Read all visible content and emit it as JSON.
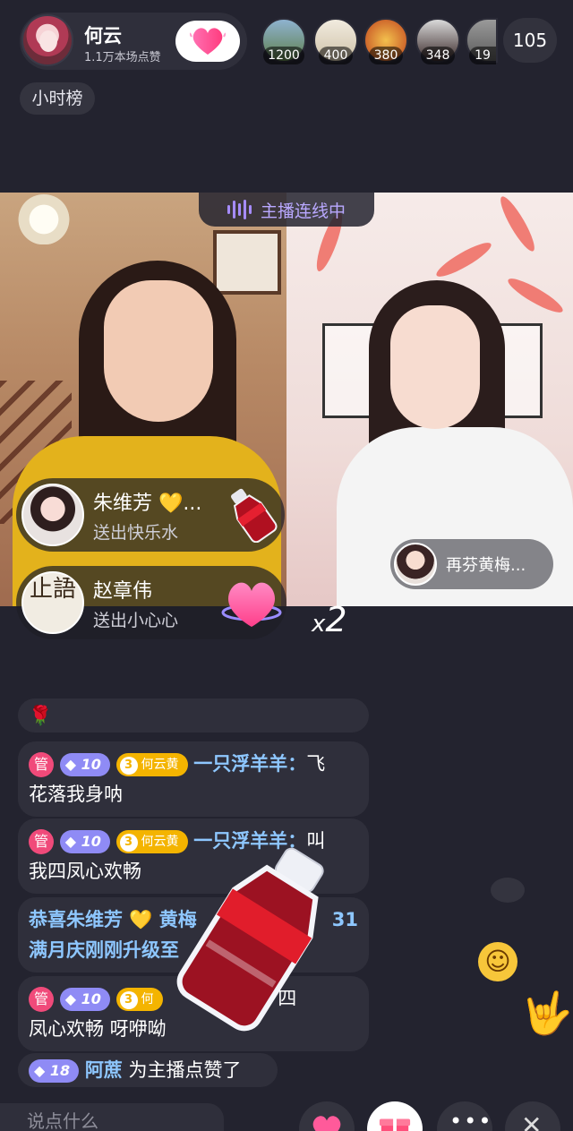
{
  "header": {
    "host_name": "何云",
    "host_likes": "1.1万本场点赞",
    "viewers": [
      {
        "badge": "1200",
        "color": "#6b8f6a"
      },
      {
        "badge": "400",
        "color": "#d9cfbd"
      },
      {
        "badge": "380",
        "color": "#e68a2e"
      },
      {
        "badge": "348",
        "color": "#4a3a3a"
      },
      {
        "badge": "19",
        "color": "#6d6d6d"
      }
    ],
    "viewer_count": "105",
    "rank_tag": "小时榜"
  },
  "video": {
    "link_status": "主播连线中",
    "guest_name": "再芬黄梅..."
  },
  "gifts": [
    {
      "name": "朱维芳 💛...",
      "desc": "送出快乐水"
    },
    {
      "name": "赵章伟",
      "desc": "送出小心心",
      "avatar_text": "止語",
      "combo_prefix": "x",
      "combo": "2"
    }
  ],
  "chat": {
    "rose": "🌹",
    "messages": [
      {
        "mgr": "管",
        "level": "10",
        "fan_level": "3",
        "fan_name": "何云黄",
        "user": "一只浮羊羊：",
        "text_inline": "飞",
        "text_line2": "花落我身呐"
      },
      {
        "mgr": "管",
        "level": "10",
        "fan_level": "3",
        "fan_name": "何云黄",
        "user": "一只浮羊羊：",
        "text_inline": "叫",
        "text_line2": "我四凤心欢畅"
      },
      {
        "line1": "恭喜朱维芳 💛 黄梅",
        "line1_end": "31",
        "line2": "满月庆刚刚升级至"
      },
      {
        "mgr": "管",
        "level": "10",
        "fan_level": "3",
        "fan_name": "何",
        "user": "羊：",
        "text_inline": "四",
        "text_line2": "凤心欢畅 呀咿呦"
      },
      {
        "level": "18",
        "user": "阿蔗",
        "text": "为主播点赞了"
      }
    ]
  },
  "bottom": {
    "input_placeholder": "说点什么"
  },
  "icons": [
    "heart-icon",
    "gift-icon",
    "more-icon",
    "close-icon",
    "laugh-emoji-icon",
    "rock-hand-icon",
    "soundwave-icon",
    "bottle-icon"
  ]
}
